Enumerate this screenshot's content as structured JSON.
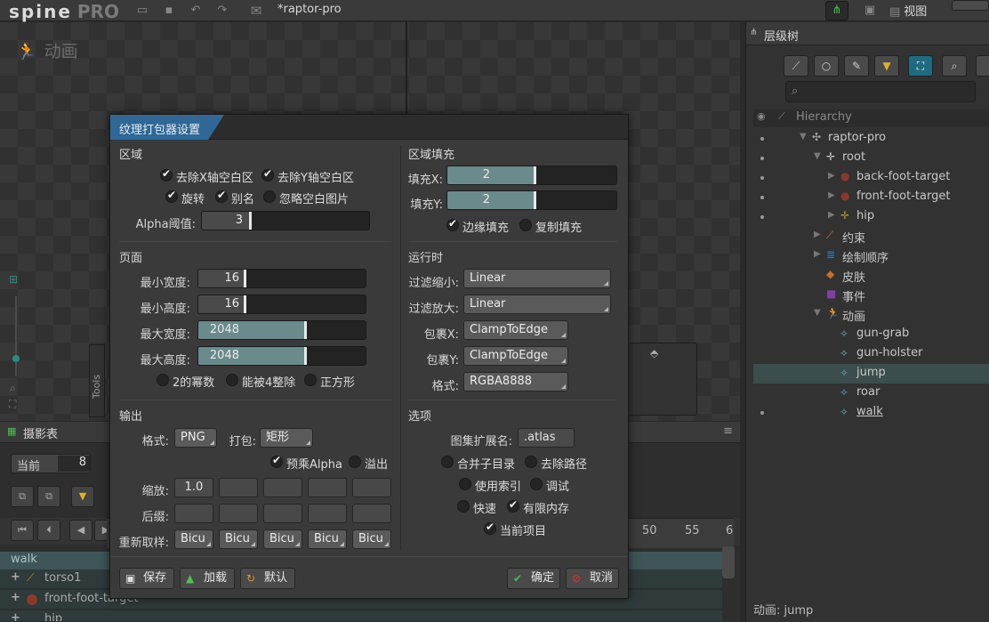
{
  "app": {
    "logo": "spine",
    "logo_suffix": "PRO",
    "document_title": "*raptor-pro",
    "view_menu": "视图"
  },
  "viewport": {
    "mode_label": "动画",
    "tools_label": "Tools"
  },
  "dopesheet": {
    "title": "摄影表",
    "current_label": "当前",
    "current_value": "8",
    "ruler": [
      "50",
      "55",
      "6"
    ],
    "walk_label": "walk",
    "rows": [
      "torso1",
      "front-foot-target",
      "hip"
    ]
  },
  "hierarchy": {
    "tab_label": "层级树",
    "header_label": "Hierarchy",
    "tree": [
      {
        "label": "raptor-pro",
        "icon": "skeleton-icon"
      },
      {
        "label": "root",
        "icon": "bone-icon"
      },
      {
        "label": "back-foot-target",
        "icon": "bone-target-icon"
      },
      {
        "label": "front-foot-target",
        "icon": "bone-target-icon"
      },
      {
        "label": "hip",
        "icon": "bone-icon"
      },
      {
        "label": "约束",
        "icon": "constraint-icon"
      },
      {
        "label": "绘制顺序",
        "icon": "draw-order-icon"
      },
      {
        "label": "皮肤",
        "icon": "skin-icon"
      },
      {
        "label": "事件",
        "icon": "event-icon"
      },
      {
        "label": "动画",
        "icon": "animation-icon"
      },
      {
        "label": "gun-grab",
        "icon": "animation-item-icon"
      },
      {
        "label": "gun-holster",
        "icon": "animation-item-icon"
      },
      {
        "label": "jump",
        "icon": "animation-item-icon"
      },
      {
        "label": "roar",
        "icon": "animation-item-icon"
      },
      {
        "label": "walk",
        "icon": "animation-item-icon"
      }
    ],
    "status": "动画: jump"
  },
  "dialog": {
    "title": "纹理打包器设置",
    "region": {
      "heading": "区域",
      "strip_x": "去除X轴空白区",
      "strip_y": "去除Y轴空白区",
      "rotate": "旋转",
      "alias": "别名",
      "ignore_blank": "忽略空白图片",
      "alpha_label": "Alpha阈值:",
      "alpha_value": "3"
    },
    "padding": {
      "heading": "区域填充",
      "pad_x_label": "填充X:",
      "pad_x_value": "2",
      "pad_y_label": "填充Y:",
      "pad_y_value": "2",
      "edge_padding": "边缘填充",
      "duplicate_padding": "复制填充"
    },
    "pages": {
      "heading": "页面",
      "min_width_label": "最小宽度:",
      "min_width_value": "16",
      "min_height_label": "最小高度:",
      "min_height_value": "16",
      "max_width_label": "最大宽度:",
      "max_width_value": "2048",
      "max_height_label": "最大高度:",
      "max_height_value": "2048",
      "pot": "2的幂数",
      "multiple_of_four": "能被4整除",
      "square": "正方形"
    },
    "runtime": {
      "heading": "运行时",
      "filter_min_label": "过滤缩小:",
      "filter_min_value": "Linear",
      "filter_mag_label": "过滤放大:",
      "filter_mag_value": "Linear",
      "wrap_x_label": "包裹X:",
      "wrap_x_value": "ClampToEdge",
      "wrap_y_label": "包裹Y:",
      "wrap_y_value": "ClampToEdge",
      "format_label": "格式:",
      "format_value": "RGBA8888"
    },
    "output": {
      "heading": "输出",
      "format_label": "格式:",
      "format_value": "PNG",
      "packing_label": "打包:",
      "packing_value": "矩形",
      "premultiply": "预乘Alpha",
      "bleed": "溢出",
      "scale_label": "缩放:",
      "scale_value": "1.0",
      "suffix_label": "后缀:",
      "resample_label": "重新取样:",
      "resample_values": [
        "Bicu",
        "Bicu",
        "Bicu",
        "Bicu",
        "Bicu"
      ]
    },
    "options": {
      "heading": "选项",
      "atlas_ext_label": "图集扩展名:",
      "atlas_ext_value": ".atlas",
      "combine_subdirs": "合并子目录",
      "strip_paths": "去除路径",
      "use_indexes": "使用索引",
      "debug": "调试",
      "fast": "快速",
      "limit_memory": "有限内存",
      "current_project": "当前项目"
    },
    "buttons": {
      "save": "保存",
      "load": "加载",
      "default": "默认",
      "ok": "确定",
      "cancel": "取消"
    }
  },
  "colors": {
    "accent": "#2f6896",
    "slider_fill": "#6a8a8c",
    "cancel_icon": "#e03030",
    "ok_icon": "#40c050"
  }
}
